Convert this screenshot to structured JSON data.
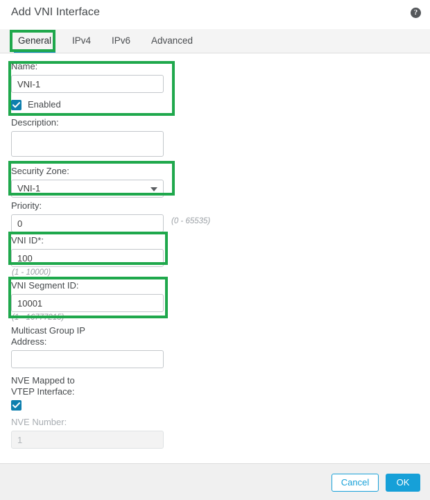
{
  "dialog": {
    "title": "Add VNI Interface",
    "help_icon": "help-circle-icon",
    "help_glyph": "?"
  },
  "tabs": [
    {
      "id": "general",
      "label": "General",
      "active": true
    },
    {
      "id": "ipv4",
      "label": "IPv4",
      "active": false
    },
    {
      "id": "ipv6",
      "label": "IPv6",
      "active": false
    },
    {
      "id": "advanced",
      "label": "Advanced",
      "active": false
    }
  ],
  "form": {
    "name": {
      "label": "Name:",
      "value": "VNI-1",
      "placeholder": ""
    },
    "enabled": {
      "label": "Enabled",
      "checked": true
    },
    "description": {
      "label": "Description:",
      "value": "",
      "placeholder": ""
    },
    "security_zone": {
      "label": "Security Zone:",
      "value": "VNI-1",
      "caret_icon": "chevron-down-icon"
    },
    "priority": {
      "label": "Priority:",
      "value": "0",
      "hint": "(0 - 65535)"
    },
    "vni_id": {
      "label": "VNI ID*:",
      "value": "100",
      "hint": "(1 - 10000)"
    },
    "vni_segment_id": {
      "label": "VNI Segment ID:",
      "value": "10001",
      "hint": "(1 - 16777215)"
    },
    "multicast_group_ip": {
      "label": "Multicast Group IP\nAddress:",
      "value": "",
      "placeholder": ""
    },
    "nve_mapped": {
      "label": "NVE Mapped to\nVTEP Interface:",
      "checked": true
    },
    "nve_number": {
      "label": "NVE Number:",
      "value": "1",
      "disabled": true
    }
  },
  "footer": {
    "cancel_label": "Cancel",
    "ok_label": "OK"
  },
  "colors": {
    "highlight_green": "#1fa84c",
    "accent_blue": "#16a0d8",
    "checkbox_blue": "#0e7fae",
    "tab_underline": "#0d8bc4",
    "footer_bg": "#f0f0f0",
    "tabbar_bg": "#f4f4f4"
  }
}
